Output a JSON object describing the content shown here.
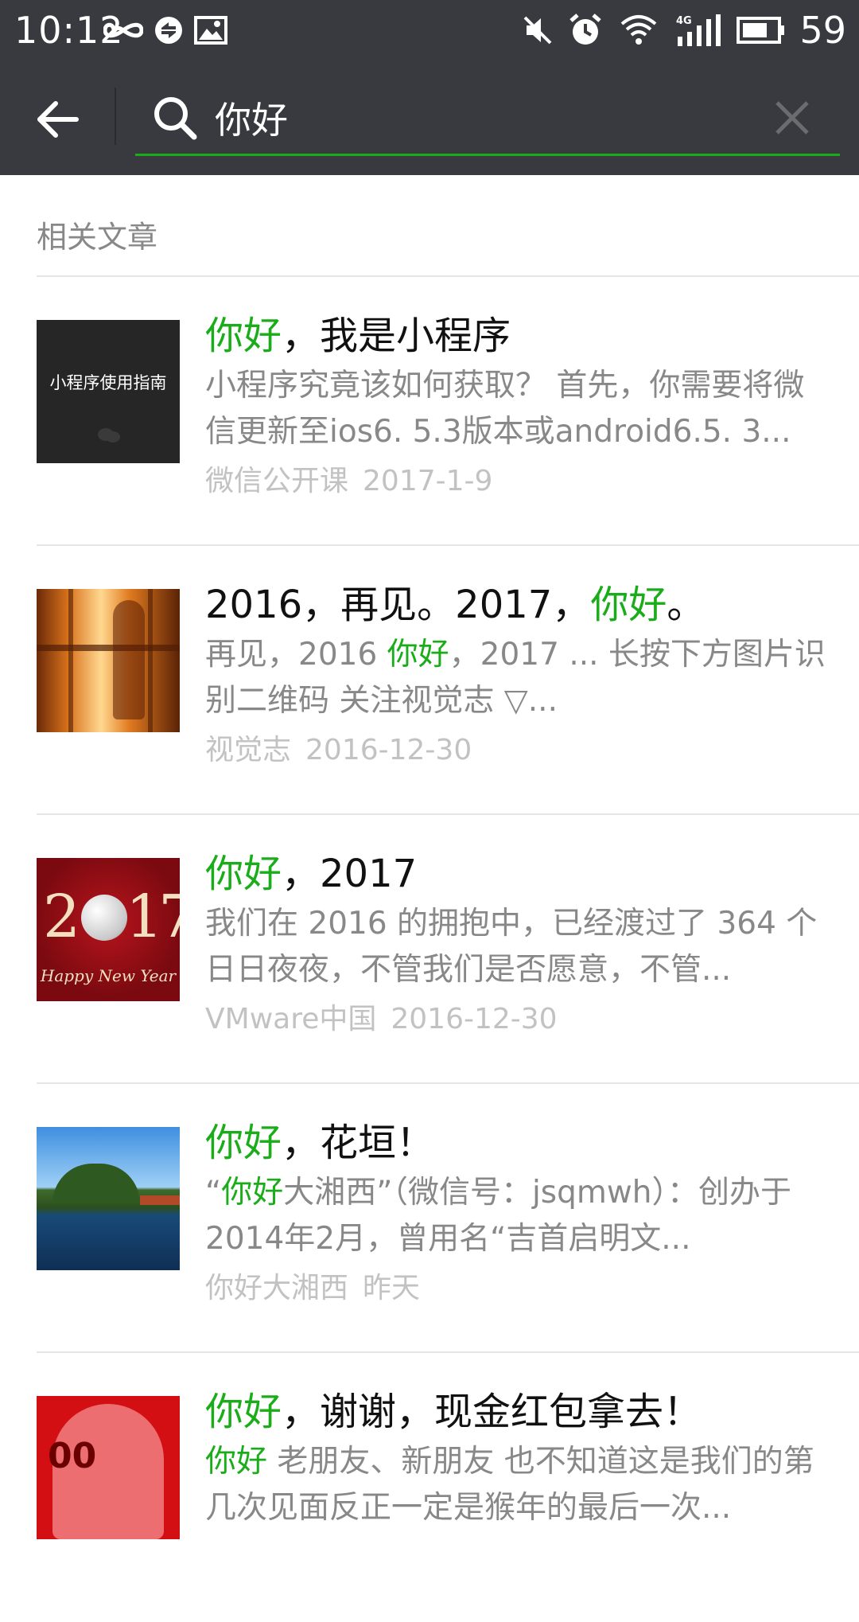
{
  "status_bar": {
    "time": "10:12",
    "battery_percent": "59",
    "left_icons": [
      "infinity-icon",
      "sync-icon",
      "image-icon"
    ],
    "right_icons": [
      "mute-icon",
      "alarm-icon",
      "wifi-icon",
      "4g-signal-icon",
      "battery-icon"
    ]
  },
  "search": {
    "query": "你好",
    "accent_color": "#1aad19"
  },
  "section": {
    "title": "相关文章"
  },
  "articles": [
    {
      "title": [
        {
          "text": "你好",
          "hl": true
        },
        {
          "text": "，我是小程序",
          "hl": false
        }
      ],
      "snippet": [
        {
          "text": "小程序究竟该如何获取？ 首先，你需要将微信更新至ios6. 5.3版本或android6.5. 3...",
          "hl": false
        }
      ],
      "source": "微信公开课",
      "date": "2017-1-9",
      "thumb_text": "小程序使用指南"
    },
    {
      "title": [
        {
          "text": "2016，再见。2017，",
          "hl": false
        },
        {
          "text": "你好",
          "hl": true
        },
        {
          "text": "。",
          "hl": false
        }
      ],
      "snippet": [
        {
          "text": "再见，2016 ",
          "hl": false
        },
        {
          "text": "你好",
          "hl": true
        },
        {
          "text": "，2017 ... 长按下方图片识别二维码 关注视觉志 ▽...",
          "hl": false
        }
      ],
      "source": "视觉志",
      "date": "2016-12-30",
      "thumb_text": ""
    },
    {
      "title": [
        {
          "text": "你好",
          "hl": true
        },
        {
          "text": "，2017",
          "hl": false
        }
      ],
      "snippet": [
        {
          "text": "我们在 2016 的拥抱中，已经渡过了 364 个日日夜夜，不管我们是否愿意，不管...",
          "hl": false
        }
      ],
      "source": "VMware中国",
      "date": "2016-12-30",
      "thumb_text": "Happy New Year"
    },
    {
      "title": [
        {
          "text": "你好",
          "hl": true
        },
        {
          "text": "，花垣！",
          "hl": false
        }
      ],
      "snippet": [
        {
          "text": "“",
          "hl": false
        },
        {
          "text": "你好",
          "hl": true
        },
        {
          "text": "大湘西”（微信号：jsqmwh）：创办于2014年2月，曾用名“吉首启明文...",
          "hl": false
        }
      ],
      "source": "你好大湘西",
      "date": "昨天",
      "thumb_text": ""
    },
    {
      "title": [
        {
          "text": "你好",
          "hl": true
        },
        {
          "text": "，谢谢，现金红包拿去！",
          "hl": false
        }
      ],
      "snippet": [
        {
          "text": "你好",
          "hl": true
        },
        {
          "text": " 老朋友、新朋友 也不知道这是我们的第几次见面反正一定是猴年的最后一次...",
          "hl": false
        }
      ],
      "source": "",
      "date": "",
      "thumb_text": ""
    }
  ]
}
